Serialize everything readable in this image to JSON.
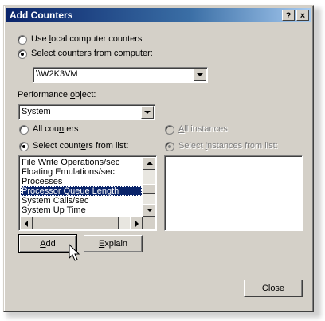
{
  "window": {
    "title": "Add Counters",
    "help_glyph": "?",
    "close_glyph": "×"
  },
  "source": {
    "local_radio": {
      "label_pre": "Use ",
      "label_u": "l",
      "label_post": "ocal computer counters",
      "checked": false
    },
    "computer_radio": {
      "label_pre": "Select counters from co",
      "label_u": "m",
      "label_post": "puter:",
      "checked": true
    },
    "computer_value": "\\\\W2K3VM"
  },
  "performance_object": {
    "label_pre": "Performance ",
    "label_u": "o",
    "label_post": "bject:",
    "value": "System"
  },
  "counters": {
    "all_radio": {
      "label_pre": "All cou",
      "label_u": "n",
      "label_post": "ters",
      "checked": false
    },
    "list_radio": {
      "label_pre": "Select count",
      "label_u": "e",
      "label_post": "rs from list:",
      "checked": true
    },
    "items": [
      "File Write Operations/sec",
      "Floating Emulations/sec",
      "Processes",
      "Processor Queue Length",
      "System Calls/sec",
      "System Up Time"
    ],
    "selected_index": 3
  },
  "instances": {
    "all_radio": {
      "label_pre": "",
      "label_u": "A",
      "label_post": "ll instances",
      "checked": false,
      "enabled": false
    },
    "list_radio": {
      "label_pre": "Select ",
      "label_u": "i",
      "label_post": "nstances from list:",
      "checked": true,
      "enabled": false
    },
    "items": []
  },
  "buttons": {
    "add": {
      "label_pre": "",
      "label_u": "A",
      "label_post": "dd"
    },
    "explain": {
      "label_pre": "",
      "label_u": "E",
      "label_post": "xplain"
    },
    "close": {
      "label_pre": "",
      "label_u": "C",
      "label_post": "lose"
    }
  },
  "icons": {
    "cursor": "mouse-pointer-icon",
    "dropdown": "chevron-down-icon"
  },
  "colors": {
    "dialog_bg": "#d4d0c8",
    "selection": "#0a246a",
    "titlebar_start": "#0a246a",
    "titlebar_end": "#a6caf0"
  }
}
